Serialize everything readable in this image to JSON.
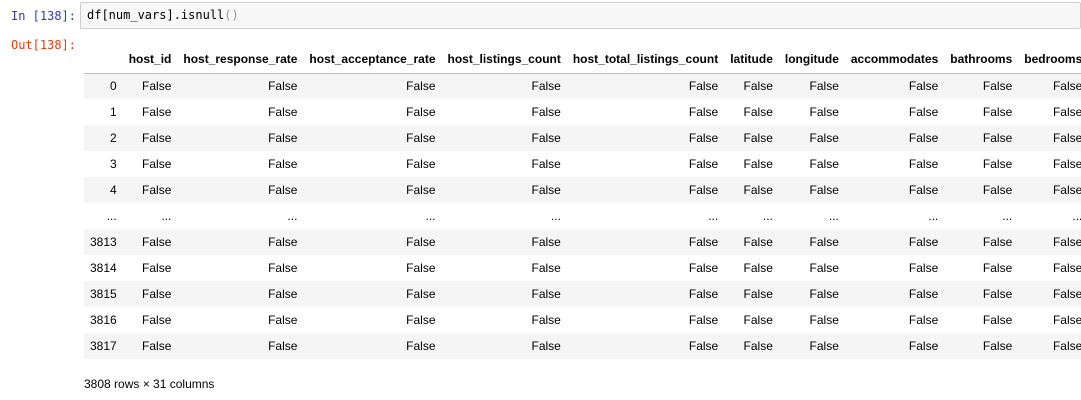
{
  "cell": {
    "in_prompt": "In [138]:",
    "out_prompt": "Out[138]:",
    "code_main": "df[num_vars].isnull",
    "code_parens": "()"
  },
  "table": {
    "index_header": "",
    "columns": [
      "host_id",
      "host_response_rate",
      "host_acceptance_rate",
      "host_listings_count",
      "host_total_listings_count",
      "latitude",
      "longitude",
      "accommodates",
      "bathrooms",
      "bedrooms"
    ],
    "rows": [
      {
        "index": "0",
        "cells": [
          "False",
          "False",
          "False",
          "False",
          "False",
          "False",
          "False",
          "False",
          "False",
          "False"
        ]
      },
      {
        "index": "1",
        "cells": [
          "False",
          "False",
          "False",
          "False",
          "False",
          "False",
          "False",
          "False",
          "False",
          "False"
        ]
      },
      {
        "index": "2",
        "cells": [
          "False",
          "False",
          "False",
          "False",
          "False",
          "False",
          "False",
          "False",
          "False",
          "False"
        ]
      },
      {
        "index": "3",
        "cells": [
          "False",
          "False",
          "False",
          "False",
          "False",
          "False",
          "False",
          "False",
          "False",
          "False"
        ]
      },
      {
        "index": "4",
        "cells": [
          "False",
          "False",
          "False",
          "False",
          "False",
          "False",
          "False",
          "False",
          "False",
          "False"
        ]
      },
      {
        "index": "...",
        "cells": [
          "...",
          "...",
          "...",
          "...",
          "...",
          "...",
          "...",
          "...",
          "...",
          "..."
        ]
      },
      {
        "index": "3813",
        "cells": [
          "False",
          "False",
          "False",
          "False",
          "False",
          "False",
          "False",
          "False",
          "False",
          "False"
        ]
      },
      {
        "index": "3814",
        "cells": [
          "False",
          "False",
          "False",
          "False",
          "False",
          "False",
          "False",
          "False",
          "False",
          "False"
        ]
      },
      {
        "index": "3815",
        "cells": [
          "False",
          "False",
          "False",
          "False",
          "False",
          "False",
          "False",
          "False",
          "False",
          "False"
        ]
      },
      {
        "index": "3816",
        "cells": [
          "False",
          "False",
          "False",
          "False",
          "False",
          "False",
          "False",
          "False",
          "False",
          "False"
        ]
      },
      {
        "index": "3817",
        "cells": [
          "False",
          "False",
          "False",
          "False",
          "False",
          "False",
          "False",
          "False",
          "False",
          "False"
        ]
      }
    ]
  },
  "shape_text": "3808 rows × 31 columns"
}
